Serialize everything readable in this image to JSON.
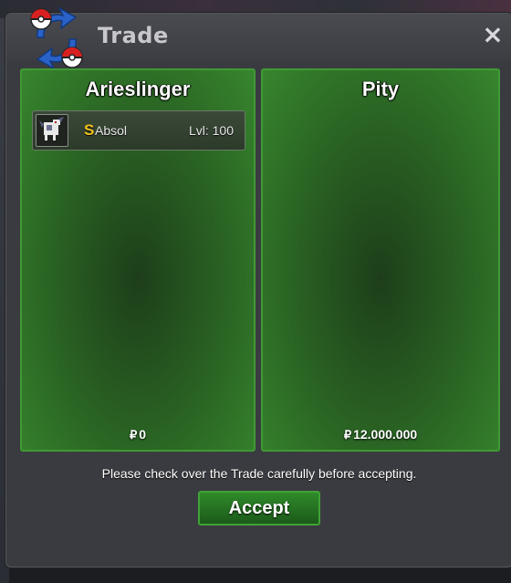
{
  "window": {
    "title": "Trade",
    "close_label": "×"
  },
  "left_panel": {
    "player_name": "Arieslinger",
    "items": [
      {
        "shiny_badge": "S",
        "name": "Absol",
        "level": "Lvl: 100",
        "icon": "absol-sprite-icon"
      }
    ],
    "currency_symbol": "₽",
    "money": "0"
  },
  "right_panel": {
    "player_name": "Pity",
    "items": [],
    "currency_symbol": "₽",
    "money": "12.000.000"
  },
  "notice": "Please check over the Trade carefully before accepting.",
  "accept_label": "Accept",
  "colors": {
    "panel_green": "#2a6423",
    "panel_border": "#3f9a33",
    "shiny_gold": "#f0c020",
    "window_bg": "#3a3b40"
  }
}
